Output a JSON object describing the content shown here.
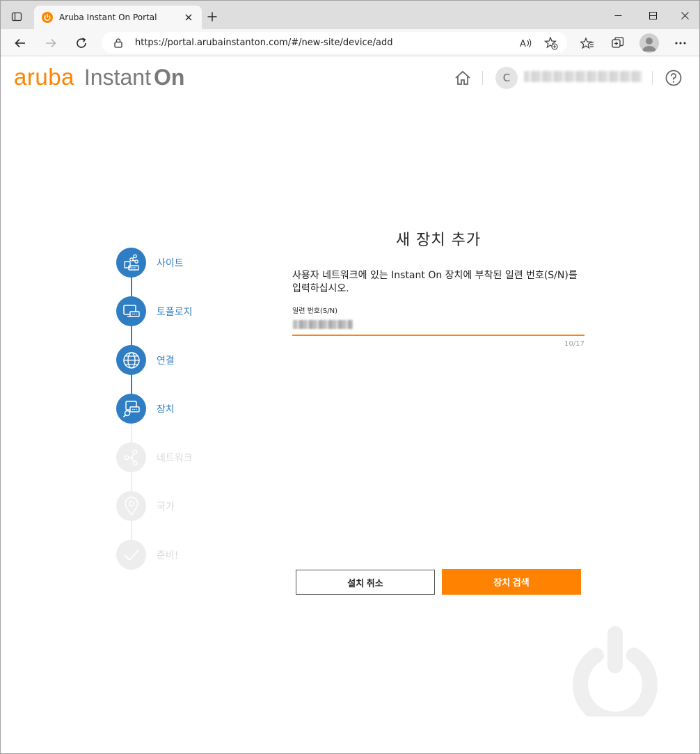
{
  "browser": {
    "tab_title": "Aruba Instant On Portal",
    "url": "https://portal.arubainstanton.com/#/new-site/device/add"
  },
  "header": {
    "brand_aruba": "aruba",
    "brand_instant": "Instant",
    "brand_on": "On",
    "user_initial": "C",
    "accent_color": "#ff8300"
  },
  "stepper": {
    "steps": [
      {
        "label": "사이트",
        "state": "done",
        "icon": "site-icon"
      },
      {
        "label": "토폴로지",
        "state": "done",
        "icon": "topology-icon"
      },
      {
        "label": "연결",
        "state": "done",
        "icon": "globe-icon"
      },
      {
        "label": "장치",
        "state": "current",
        "icon": "device-search-icon"
      },
      {
        "label": "네트워크",
        "state": "pending",
        "icon": "network-icon"
      },
      {
        "label": "국가",
        "state": "pending",
        "icon": "location-pin-icon"
      },
      {
        "label": "준비!",
        "state": "pending",
        "icon": "checkmark-icon"
      }
    ],
    "active_color": "#2f7ec4"
  },
  "form": {
    "title": "새 장치 추가",
    "description": "사용자 네트워크에 있는 Instant On 장치에 부착된 일련 번호(S/N)를 입력하십시오.",
    "serial_label": "일련 번호(S/N)",
    "serial_counter": "10/17",
    "cancel_label": "설치 취소",
    "search_label": "장치 검색"
  }
}
